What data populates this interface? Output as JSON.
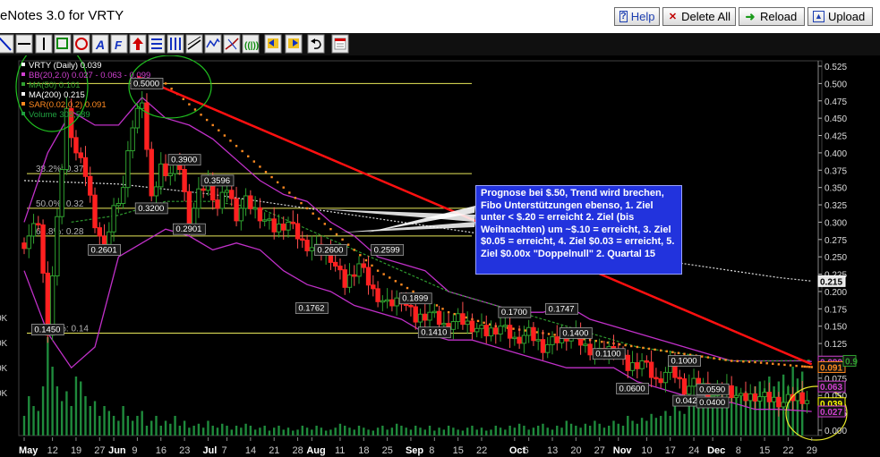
{
  "app": {
    "title": "eNotes 3.0 for VRTY"
  },
  "buttons": {
    "help": "Help",
    "delete_all": "Delete All",
    "reload": "Reload",
    "upload": "Upload"
  },
  "toolbar": {
    "tools": [
      "line-tool",
      "hline-tool",
      "vline-tool",
      "rect-tool",
      "circle-tool",
      "text-tool",
      "fibonacci-tool",
      "arrow-up-tool",
      "hlines-tool",
      "vlines-tool",
      "channel-tool",
      "wave-tool",
      "pitchfork-tool",
      "cycles-tool",
      "move-left-tool",
      "move-right-tool",
      "undo-tool",
      "save-tool"
    ]
  },
  "chart": {
    "legend": [
      {
        "text": "VRTY (Daily) 0.039",
        "color": "#ffffff"
      },
      {
        "text": "BB(20,2.0) 0.027 - 0.063 - 0.099",
        "color": "#d040d0"
      },
      {
        "text": "MA(50) 0.101",
        "color": "#30a030"
      },
      {
        "text": "MA(200) 0.215",
        "color": "#ffffff"
      },
      {
        "text": "SAR(0.02,0.2) 0.091",
        "color": "#ff8a20"
      },
      {
        "text": "Volume 308,589",
        "color": "#20a040"
      }
    ],
    "note": "Prognose bei $.50, Trend wird brechen, Fibo Unterstützungen ebenso, 1. Ziel unter < $.20 = erreicht 2. Ziel (bis Weihnachten) um ~$.10 = erreicht, 3. Ziel $0.05 = erreicht, 4. Ziel $0.03 = erreicht, 5. Ziel $0.00x \"Doppelnull\" 2. Quartal 15",
    "fib_labels": [
      {
        "text": "38.2%: 0.37",
        "price": 0.37
      },
      {
        "text": "50.0%: 0.32",
        "price": 0.32
      },
      {
        "text": "61.8%: 0.28",
        "price": 0.28
      },
      {
        "text": "100.0%: 0.14",
        "price": 0.14
      }
    ],
    "price_labels": [
      {
        "text": "0.5000",
        "day": 26,
        "price": 0.5
      },
      {
        "text": "0.3900",
        "day": 34,
        "price": 0.39
      },
      {
        "text": "0.3596",
        "day": 41,
        "price": 0.36
      },
      {
        "text": "0.3200",
        "day": 27,
        "price": 0.32
      },
      {
        "text": "0.2901",
        "day": 35,
        "price": 0.29
      },
      {
        "text": "0.2601",
        "day": 17,
        "price": 0.26
      },
      {
        "text": "0.2600",
        "day": 65,
        "price": 0.26
      },
      {
        "text": "0.2599",
        "day": 77,
        "price": 0.26
      },
      {
        "text": "0.1899",
        "day": 83,
        "price": 0.19
      },
      {
        "text": "0.1762",
        "day": 61,
        "price": 0.176
      },
      {
        "text": "0.1410",
        "day": 87,
        "price": 0.141
      },
      {
        "text": "0.1700",
        "day": 104,
        "price": 0.17
      },
      {
        "text": "0.1747",
        "day": 114,
        "price": 0.175
      },
      {
        "text": "0.1400",
        "day": 117,
        "price": 0.14
      },
      {
        "text": "0.1100",
        "day": 124,
        "price": 0.11
      },
      {
        "text": "0.1000",
        "day": 140,
        "price": 0.1
      },
      {
        "text": "0.0600",
        "day": 129,
        "price": 0.06
      },
      {
        "text": "0.0590",
        "day": 146,
        "price": 0.059
      },
      {
        "text": "0.0425",
        "day": 141,
        "price": 0.0425
      },
      {
        "text": "0.0400",
        "day": 146,
        "price": 0.04
      },
      {
        "text": "0.1450",
        "day": 5,
        "price": 0.145
      }
    ],
    "right_tags": [
      {
        "text": "0.215",
        "price": 0.215,
        "color": "#ffffff"
      },
      {
        "text": "0.099",
        "price": 0.099,
        "color": "#d040d0"
      },
      {
        "text": "0.091",
        "price": 0.091,
        "color": "#ff8a20"
      },
      {
        "text": "0.063",
        "price": 0.063,
        "color": "#d040d0"
      },
      {
        "text": "0.039",
        "price": 0.039,
        "color": "#ffff00"
      },
      {
        "text": "0.027",
        "price": 0.027,
        "color": "#d040d0"
      },
      {
        "text": "0.9",
        "price": 0.1,
        "color": "#30a030"
      }
    ],
    "left_volume_labels": [
      "0K",
      "0K",
      "0K",
      "0K"
    ]
  },
  "chart_data": {
    "type": "candlestick",
    "title": "VRTY (Daily)",
    "ylim": [
      0,
      0.525
    ],
    "y_ticks": [
      0.0,
      0.025,
      0.05,
      0.075,
      0.1,
      0.125,
      0.15,
      0.175,
      0.2,
      0.225,
      0.25,
      0.275,
      0.3,
      0.325,
      0.35,
      0.375,
      0.4,
      0.425,
      0.45,
      0.475,
      0.5,
      0.525
    ],
    "y_tick_labels": [
      "0.000",
      "0.025",
      "0.050",
      "0.075",
      "0.100",
      "0.125",
      "0.150",
      "0.175",
      "0.200",
      "0.225",
      "0.250",
      "0.275",
      "0.300",
      "0.325",
      "0.350",
      "0.375",
      "0.400",
      "0.425",
      "0.450",
      "0.475",
      "0.500",
      "0.525"
    ],
    "x_ticks": [
      {
        "label": "May",
        "day": 0,
        "month": true
      },
      {
        "label": "12",
        "day": 6
      },
      {
        "label": "19",
        "day": 11
      },
      {
        "label": "27",
        "day": 16
      },
      {
        "label": "Jun",
        "day": 19,
        "month": true
      },
      {
        "label": "9",
        "day": 24
      },
      {
        "label": "16",
        "day": 29
      },
      {
        "label": "23",
        "day": 34
      },
      {
        "label": "Jul",
        "day": 39,
        "month": true
      },
      {
        "label": "7",
        "day": 43
      },
      {
        "label": "14",
        "day": 48
      },
      {
        "label": "21",
        "day": 53
      },
      {
        "label": "28",
        "day": 58
      },
      {
        "label": "Aug",
        "day": 61,
        "month": true
      },
      {
        "label": "11",
        "day": 67
      },
      {
        "label": "18",
        "day": 72
      },
      {
        "label": "25",
        "day": 77
      },
      {
        "label": "Sep",
        "day": 82,
        "month": true
      },
      {
        "label": "8",
        "day": 87
      },
      {
        "label": "15",
        "day": 92
      },
      {
        "label": "22",
        "day": 97
      },
      {
        "label": "Oct",
        "day": 104,
        "month": true
      },
      {
        "label": "6",
        "day": 107
      },
      {
        "label": "13",
        "day": 112
      },
      {
        "label": "20",
        "day": 117
      },
      {
        "label": "27",
        "day": 122
      },
      {
        "label": "Nov",
        "day": 126,
        "month": true
      },
      {
        "label": "10",
        "day": 132
      },
      {
        "label": "17",
        "day": 137
      },
      {
        "label": "24",
        "day": 142
      },
      {
        "label": "Dec",
        "day": 146,
        "month": true
      },
      {
        "label": "8",
        "day": 152
      },
      {
        "label": "15",
        "day": 157
      },
      {
        "label": "22",
        "day": 162
      },
      {
        "label": "29",
        "day": 167
      }
    ],
    "close_path": [
      [
        0,
        0.27
      ],
      [
        3,
        0.3
      ],
      [
        5,
        0.145
      ],
      [
        7,
        0.3
      ],
      [
        9,
        0.46
      ],
      [
        11,
        0.4
      ],
      [
        13,
        0.37
      ],
      [
        15,
        0.3
      ],
      [
        17,
        0.26
      ],
      [
        19,
        0.32
      ],
      [
        21,
        0.35
      ],
      [
        23,
        0.44
      ],
      [
        25,
        0.48
      ],
      [
        27,
        0.33
      ],
      [
        29,
        0.38
      ],
      [
        31,
        0.37
      ],
      [
        33,
        0.38
      ],
      [
        35,
        0.3
      ],
      [
        37,
        0.34
      ],
      [
        39,
        0.36
      ],
      [
        41,
        0.32
      ],
      [
        43,
        0.35
      ],
      [
        45,
        0.31
      ],
      [
        47,
        0.33
      ],
      [
        50,
        0.31
      ],
      [
        53,
        0.29
      ],
      [
        56,
        0.3
      ],
      [
        59,
        0.27
      ],
      [
        62,
        0.26
      ],
      [
        65,
        0.25
      ],
      [
        68,
        0.21
      ],
      [
        71,
        0.24
      ],
      [
        74,
        0.2
      ],
      [
        77,
        0.18
      ],
      [
        80,
        0.19
      ],
      [
        83,
        0.16
      ],
      [
        86,
        0.17
      ],
      [
        89,
        0.15
      ],
      [
        92,
        0.16
      ],
      [
        95,
        0.15
      ],
      [
        98,
        0.14
      ],
      [
        101,
        0.15
      ],
      [
        104,
        0.13
      ],
      [
        107,
        0.14
      ],
      [
        110,
        0.12
      ],
      [
        113,
        0.13
      ],
      [
        116,
        0.14
      ],
      [
        119,
        0.12
      ],
      [
        122,
        0.11
      ],
      [
        125,
        0.12
      ],
      [
        128,
        0.09
      ],
      [
        131,
        0.1
      ],
      [
        134,
        0.07
      ],
      [
        137,
        0.09
      ],
      [
        140,
        0.06
      ],
      [
        143,
        0.07
      ],
      [
        146,
        0.05
      ],
      [
        149,
        0.06
      ],
      [
        152,
        0.045
      ],
      [
        155,
        0.05
      ],
      [
        158,
        0.045
      ],
      [
        161,
        0.04
      ],
      [
        164,
        0.05
      ],
      [
        167,
        0.039
      ]
    ],
    "bb_upper": [
      [
        0,
        0.3
      ],
      [
        5,
        0.4
      ],
      [
        10,
        0.46
      ],
      [
        15,
        0.44
      ],
      [
        20,
        0.44
      ],
      [
        25,
        0.48
      ],
      [
        30,
        0.45
      ],
      [
        35,
        0.44
      ],
      [
        40,
        0.42
      ],
      [
        45,
        0.39
      ],
      [
        50,
        0.36
      ],
      [
        55,
        0.34
      ],
      [
        60,
        0.33
      ],
      [
        65,
        0.3
      ],
      [
        70,
        0.28
      ],
      [
        75,
        0.25
      ],
      [
        80,
        0.24
      ],
      [
        85,
        0.23
      ],
      [
        90,
        0.2
      ],
      [
        95,
        0.19
      ],
      [
        100,
        0.18
      ],
      [
        105,
        0.17
      ],
      [
        110,
        0.17
      ],
      [
        115,
        0.18
      ],
      [
        120,
        0.16
      ],
      [
        125,
        0.15
      ],
      [
        130,
        0.14
      ],
      [
        135,
        0.13
      ],
      [
        140,
        0.12
      ],
      [
        145,
        0.11
      ],
      [
        150,
        0.1
      ],
      [
        155,
        0.1
      ],
      [
        160,
        0.1
      ],
      [
        165,
        0.1
      ],
      [
        167,
        0.099
      ]
    ],
    "bb_lower": [
      [
        0,
        0.23
      ],
      [
        5,
        0.14
      ],
      [
        10,
        0.09
      ],
      [
        15,
        0.12
      ],
      [
        20,
        0.25
      ],
      [
        25,
        0.27
      ],
      [
        30,
        0.29
      ],
      [
        35,
        0.28
      ],
      [
        40,
        0.26
      ],
      [
        45,
        0.27
      ],
      [
        50,
        0.26
      ],
      [
        55,
        0.23
      ],
      [
        60,
        0.21
      ],
      [
        65,
        0.2
      ],
      [
        70,
        0.18
      ],
      [
        75,
        0.17
      ],
      [
        80,
        0.16
      ],
      [
        85,
        0.14
      ],
      [
        90,
        0.13
      ],
      [
        95,
        0.13
      ],
      [
        100,
        0.12
      ],
      [
        105,
        0.11
      ],
      [
        110,
        0.1
      ],
      [
        115,
        0.09
      ],
      [
        120,
        0.09
      ],
      [
        125,
        0.09
      ],
      [
        130,
        0.07
      ],
      [
        135,
        0.06
      ],
      [
        140,
        0.05
      ],
      [
        145,
        0.04
      ],
      [
        150,
        0.04
      ],
      [
        155,
        0.03
      ],
      [
        160,
        0.03
      ],
      [
        165,
        0.028
      ],
      [
        167,
        0.027
      ]
    ],
    "ma50": [
      [
        10,
        0.3
      ],
      [
        20,
        0.31
      ],
      [
        30,
        0.33
      ],
      [
        40,
        0.33
      ],
      [
        50,
        0.32
      ],
      [
        60,
        0.29
      ],
      [
        70,
        0.26
      ],
      [
        80,
        0.23
      ],
      [
        90,
        0.2
      ],
      [
        100,
        0.18
      ],
      [
        110,
        0.16
      ],
      [
        120,
        0.14
      ],
      [
        130,
        0.12
      ],
      [
        140,
        0.11
      ],
      [
        150,
        0.1
      ],
      [
        160,
        0.1
      ],
      [
        167,
        0.101
      ]
    ],
    "ma200": [
      [
        0,
        0.36
      ],
      [
        20,
        0.355
      ],
      [
        40,
        0.34
      ],
      [
        60,
        0.32
      ],
      [
        80,
        0.3
      ],
      [
        100,
        0.28
      ],
      [
        120,
        0.26
      ],
      [
        140,
        0.24
      ],
      [
        160,
        0.22
      ],
      [
        167,
        0.215
      ]
    ],
    "sar": [
      [
        30,
        0.5
      ],
      [
        35,
        0.47
      ],
      [
        40,
        0.44
      ],
      [
        45,
        0.41
      ],
      [
        50,
        0.38
      ],
      [
        55,
        0.35
      ],
      [
        60,
        0.32
      ],
      [
        65,
        0.29
      ],
      [
        70,
        0.26
      ],
      [
        75,
        0.23
      ],
      [
        80,
        0.21
      ],
      [
        85,
        0.19
      ],
      [
        90,
        0.17
      ],
      [
        95,
        0.16
      ],
      [
        100,
        0.15
      ],
      [
        105,
        0.145
      ],
      [
        110,
        0.14
      ],
      [
        115,
        0.135
      ],
      [
        120,
        0.13
      ],
      [
        125,
        0.125
      ],
      [
        130,
        0.12
      ],
      [
        135,
        0.115
      ],
      [
        140,
        0.11
      ],
      [
        145,
        0.105
      ],
      [
        150,
        0.1
      ],
      [
        155,
        0.098
      ],
      [
        160,
        0.095
      ],
      [
        165,
        0.092
      ],
      [
        167,
        0.091
      ]
    ],
    "trendline": [
      [
        24,
        0.51
      ],
      [
        167,
        0.095
      ]
    ],
    "volume_bars": [
      0.2,
      0.4,
      0.3,
      0.25,
      0.5,
      1.0,
      0.7,
      0.5,
      0.35,
      0.45,
      0.3,
      0.6,
      0.55,
      0.4,
      0.3,
      0.35,
      0.2,
      0.3,
      0.25,
      0.2,
      0.15,
      0.3,
      0.2,
      0.15,
      0.2,
      0.25,
      0.1,
      0.15,
      0.2,
      0.1,
      0.15,
      0.12,
      0.2,
      0.1,
      0.15,
      0.08,
      0.1,
      0.12,
      0.08,
      0.15,
      0.1,
      0.08,
      0.12,
      0.1,
      0.06,
      0.1,
      0.08,
      0.12,
      0.1,
      0.06,
      0.08,
      0.1,
      0.05,
      0.08,
      0.1,
      0.06,
      0.08,
      0.05,
      0.06,
      0.1,
      0.08,
      0.06,
      0.1,
      0.08,
      0.05,
      0.06,
      0.08,
      0.12,
      0.1,
      0.08,
      0.06,
      0.1,
      0.08,
      0.06,
      0.05,
      0.08,
      0.1,
      0.06,
      0.08,
      0.12,
      0.1,
      0.08,
      0.06,
      0.1,
      0.08,
      0.06,
      0.1,
      0.05,
      0.08,
      0.06,
      0.1,
      0.08,
      0.06,
      0.05,
      0.08,
      0.1,
      0.06,
      0.08,
      0.05,
      0.06,
      0.1,
      0.08,
      0.06,
      0.1,
      0.08,
      0.12,
      0.1,
      0.06,
      0.08,
      0.1,
      0.12,
      0.08,
      0.06,
      0.1,
      0.08,
      0.15,
      0.12,
      0.1,
      0.08,
      0.12,
      0.1,
      0.15,
      0.12,
      0.08,
      0.1,
      0.15,
      0.12,
      0.1,
      0.2,
      0.15,
      0.12,
      0.18,
      0.15,
      0.22,
      0.18,
      0.2,
      0.25,
      0.2,
      0.3,
      0.25,
      0.22,
      0.35,
      0.3,
      0.28,
      0.4,
      0.35,
      0.3,
      0.38,
      0.45,
      0.35,
      0.42,
      0.5,
      0.4,
      0.45,
      0.38,
      0.5,
      0.55,
      0.48,
      0.6,
      0.5,
      0.55,
      0.62,
      0.5,
      0.7,
      0.58,
      0.65
    ]
  }
}
